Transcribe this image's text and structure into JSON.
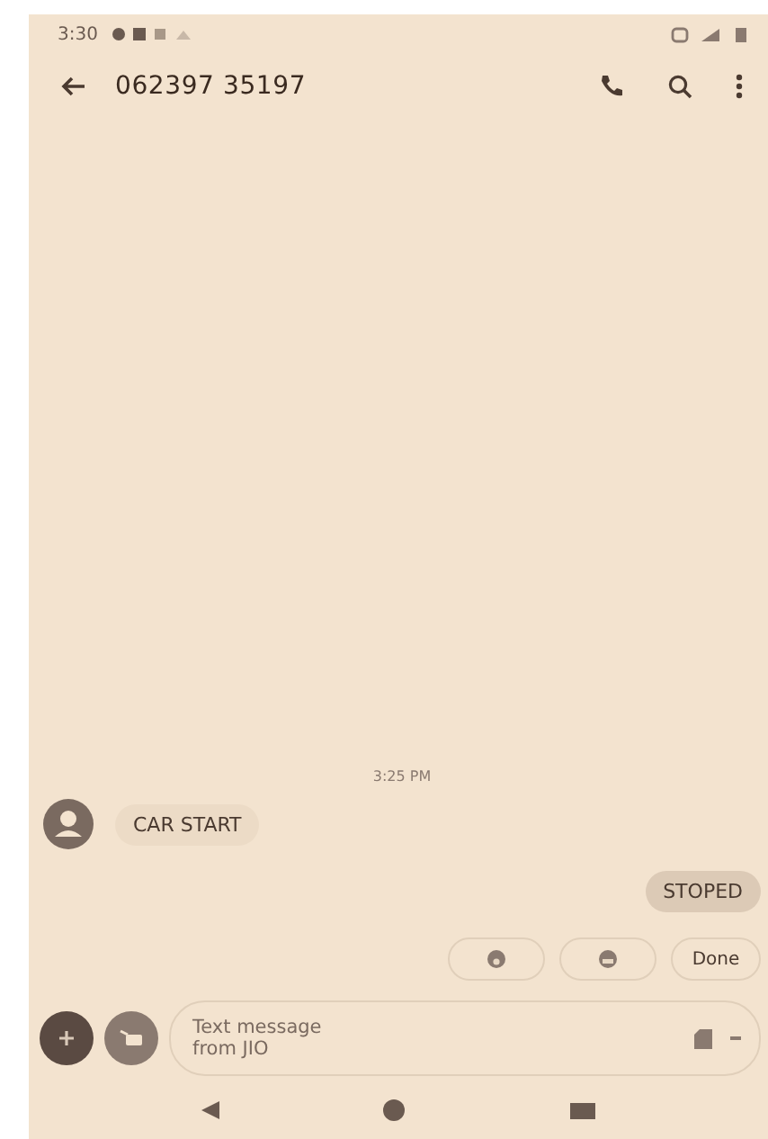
{
  "status_bar": {
    "time": "3:30"
  },
  "app_bar": {
    "title": "062397 35197"
  },
  "messages": [
    {
      "kind": "timestamp",
      "text": "3:25 PM"
    },
    {
      "kind": "incoming",
      "text": "CAR START"
    },
    {
      "kind": "outgoing",
      "text": "STOPED"
    }
  ],
  "suggestions": [
    {
      "kind": "emoji"
    },
    {
      "kind": "emoji-grin"
    },
    {
      "kind": "text",
      "label": "Done"
    }
  ],
  "compose": {
    "placeholder": "Text message from JIO"
  }
}
